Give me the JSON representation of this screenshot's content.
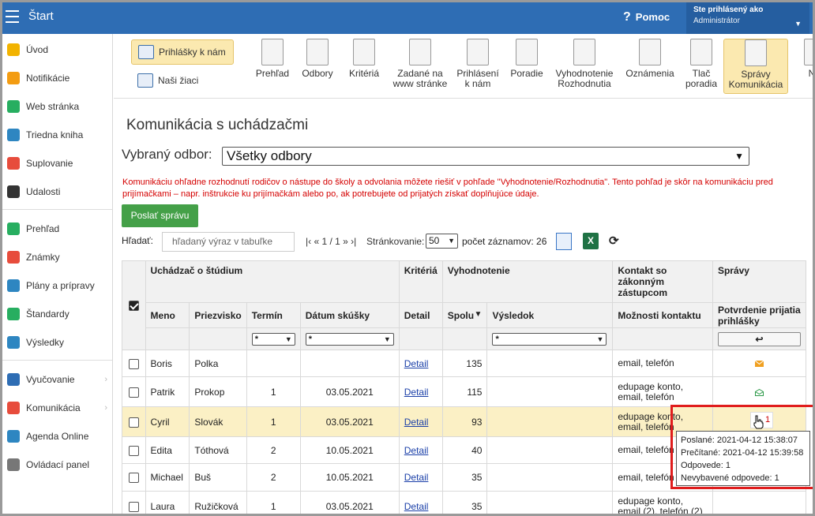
{
  "topbar": {
    "start_label": "Štart",
    "help_label": "Pomoc",
    "user_line1": "Ste prihlásený ako",
    "user_line2": "Administrátor"
  },
  "sidebar": {
    "items": [
      {
        "label": "Úvod",
        "icon": "star-icon",
        "color": "#f2b300"
      },
      {
        "label": "Notifikácie",
        "icon": "envelope-icon",
        "color": "#f39c12"
      },
      {
        "label": "Web stránka",
        "icon": "home-icon",
        "color": "#27ae60"
      },
      {
        "label": "Triedna kniha",
        "icon": "book-icon",
        "color": "#2e86c1"
      },
      {
        "label": "Suplovanie",
        "icon": "person-icon",
        "color": "#e74c3c"
      },
      {
        "label": "Udalosti",
        "icon": "calendar-icon",
        "color": "#333333"
      },
      {
        "label": "Prehľad",
        "icon": "check-circle-icon",
        "color": "#27ae60"
      },
      {
        "label": "Známky",
        "icon": "grade-icon",
        "color": "#e74c3c"
      },
      {
        "label": "Plány a prípravy",
        "icon": "briefcase-icon",
        "color": "#2e86c1"
      },
      {
        "label": "Štandardy",
        "icon": "shield-icon",
        "color": "#27ae60"
      },
      {
        "label": "Výsledky",
        "icon": "bar-chart-icon",
        "color": "#2e86c1"
      },
      {
        "label": "Vyučovanie",
        "icon": "school-icon",
        "color": "#2e6db4"
      },
      {
        "label": "Komunikácia",
        "icon": "chat-icon",
        "color": "#e74c3c"
      },
      {
        "label": "Agenda Online",
        "icon": "pen-icon",
        "color": "#2e86c1"
      },
      {
        "label": "Ovládací panel",
        "icon": "gear-icon",
        "color": "#777777"
      }
    ]
  },
  "toolbar": {
    "left_buttons": [
      "Prihlášky k nám",
      "Naši žiaci"
    ],
    "buttons": [
      {
        "line1": "Prehľad",
        "line2": ""
      },
      {
        "line1": "Odbory",
        "line2": ""
      },
      {
        "line1": "Kritériá",
        "line2": ""
      },
      {
        "line1": "Zadané na",
        "line2": "www stránke"
      },
      {
        "line1": "Prihlásení",
        "line2": "k nám"
      },
      {
        "line1": "Poradie",
        "line2": ""
      },
      {
        "line1": "Vyhodnotenie",
        "line2": "Rozhodnutia"
      },
      {
        "line1": "Oznámenia",
        "line2": ""
      },
      {
        "line1": "Tlač",
        "line2": "poradia"
      },
      {
        "line1": "Správy",
        "line2": "Komunikácia"
      },
      {
        "line1": "N",
        "line2": ""
      }
    ]
  },
  "main": {
    "title": "Komunikácia s uchádzačmi",
    "odbor_label": "Vybraný odbor:",
    "odbor_value": "Všetky odbory",
    "warning": "Komunikáciu ohľadne rozhodnutí rodičov o nástupe do školy a odvolania môžete riešiť v pohľade \"Vyhodnotenie/Rozhodnutia\". Tento pohľad je skôr na komunikáciu pred prijímačkami – napr. inštrukcie ku prijímačkám alebo po, ak potrebujete od prijatých získať doplňujúce údaje.",
    "send_button": "Poslať správu",
    "filter_label": "Hľadať:",
    "search_placeholder": "hľadaný výraz v tabuľke",
    "pager_text": "|‹ « 1 / 1 » ›|",
    "paging_label": "Stránkovanie:",
    "paging_value": "50",
    "record_count": "počet záznamov: 26",
    "xls_label": "X"
  },
  "table": {
    "group_headers": [
      "Uchádzač o štúdium",
      "Kritériá",
      "Vyhodnotenie",
      "Kontakt so zákonným zástupcom",
      "Správy"
    ],
    "columns": [
      "Meno",
      "Priezvisko",
      "Termín",
      "Dátum skúšky",
      "Detail",
      "Spolu",
      "Výsledok",
      "Možnosti kontaktu",
      "Potvrdenie prijatia prihlášky"
    ],
    "filter_star": "*",
    "sort_arrow": "▼",
    "rows": [
      {
        "meno": "Boris",
        "priezvisko": "Polka",
        "termin": "",
        "datum": "",
        "detail": "Detail",
        "spolu": "135",
        "vysledok": "",
        "kontakt": "email, telefón",
        "sprava": "envelope-closed",
        "highlight": false
      },
      {
        "meno": "Patrik",
        "priezvisko": "Prokop",
        "termin": "1",
        "datum": "03.05.2021",
        "detail": "Detail",
        "spolu": "115",
        "vysledok": "",
        "kontakt": "edupage konto, email, telefón",
        "sprava": "envelope-open",
        "highlight": false
      },
      {
        "meno": "Cyril",
        "priezvisko": "Slovák",
        "termin": "1",
        "datum": "03.05.2021",
        "detail": "Detail",
        "spolu": "93",
        "vysledok": "",
        "kontakt": "edupage konto, email, telefón",
        "sprava": "reply",
        "highlight": true
      },
      {
        "meno": "Edita",
        "priezvisko": "Tóthová",
        "termin": "2",
        "datum": "10.05.2021",
        "detail": "Detail",
        "spolu": "40",
        "vysledok": "",
        "kontakt": "email, telefón",
        "sprava": "",
        "highlight": false
      },
      {
        "meno": "Michael",
        "priezvisko": "Buš",
        "termin": "2",
        "datum": "10.05.2021",
        "detail": "Detail",
        "spolu": "35",
        "vysledok": "",
        "kontakt": "email, telefón",
        "sprava": "",
        "highlight": false
      },
      {
        "meno": "Laura",
        "priezvisko": "Ružičková",
        "termin": "1",
        "datum": "03.05.2021",
        "detail": "Detail",
        "spolu": "35",
        "vysledok": "",
        "kontakt": "edupage konto, email (2), telefón (2)",
        "sprava": "",
        "highlight": false
      }
    ]
  },
  "reply_badge": "1",
  "tooltip": {
    "line1": "Poslané: 2021-04-12 15:38:07",
    "line2": "Prečítané: 2021-04-12 15:39:58",
    "line3": "Odpovede: 1",
    "line4": "Nevybavené odpovede: 1"
  }
}
